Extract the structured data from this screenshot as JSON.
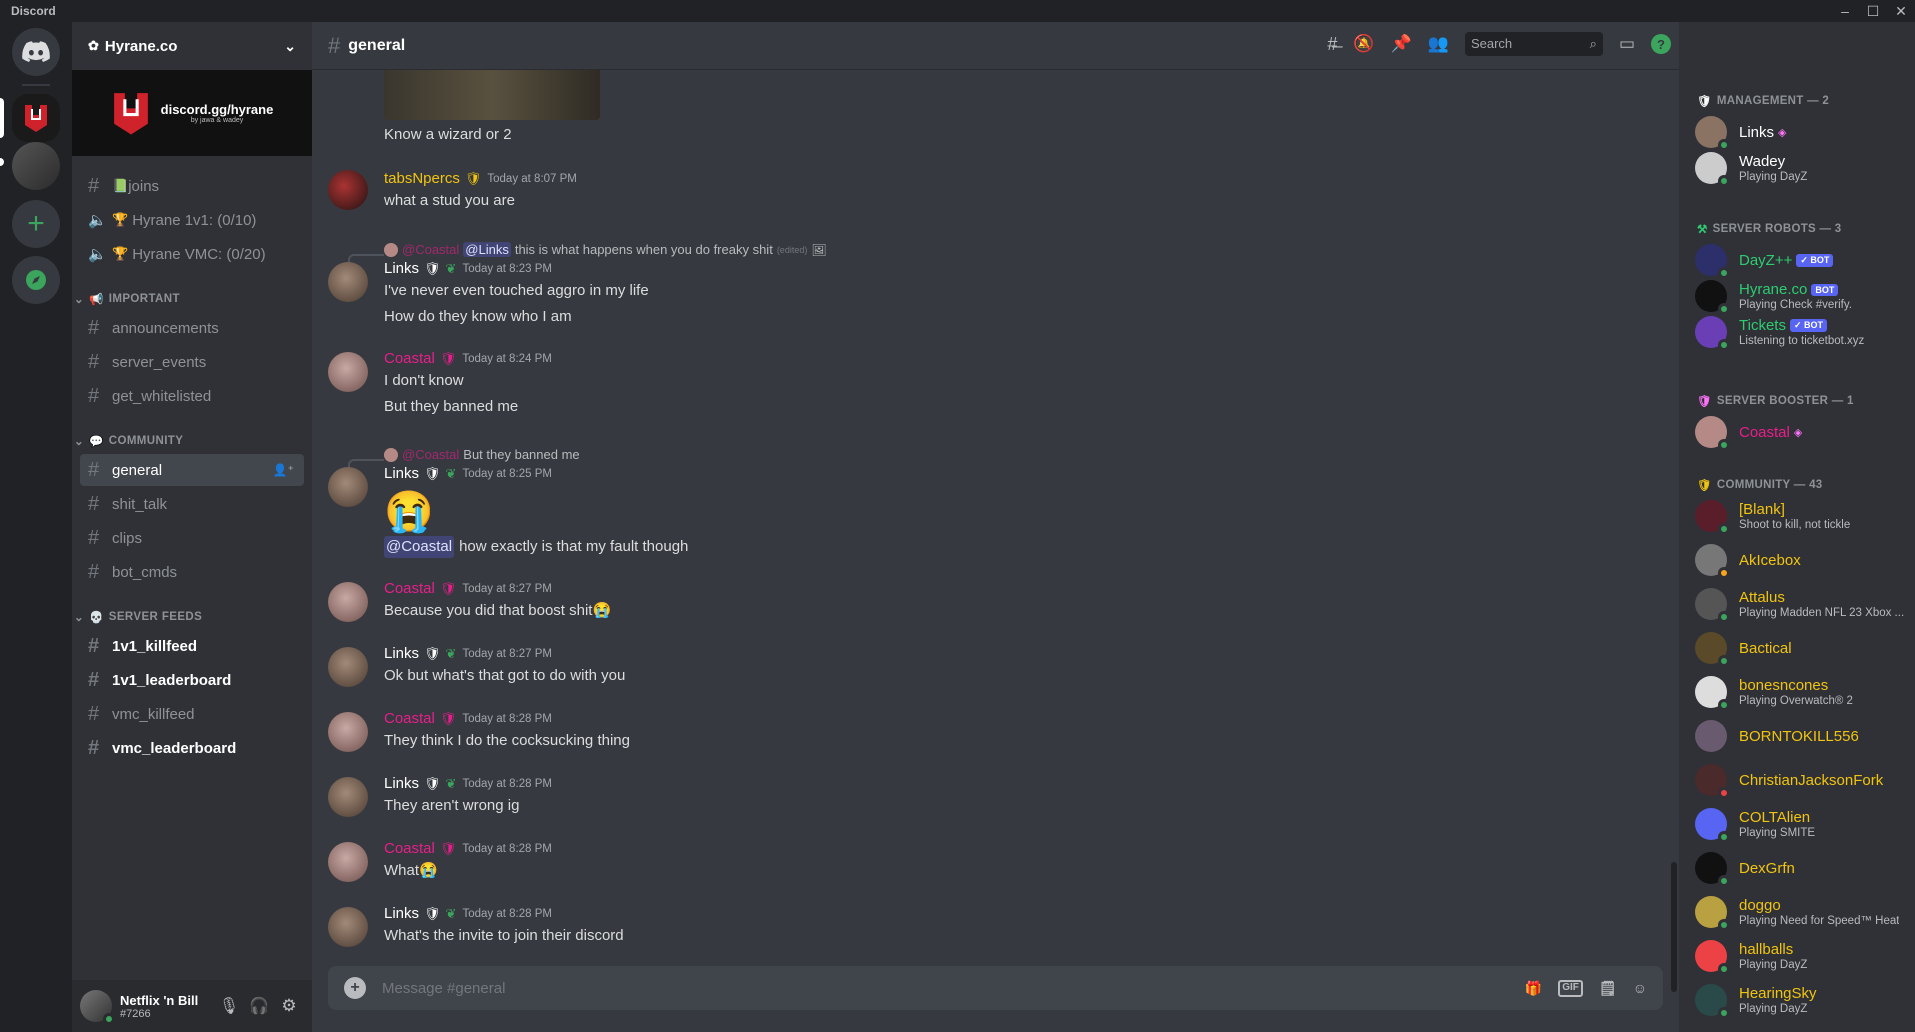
{
  "window": {
    "title": "Discord"
  },
  "server": {
    "name": "Hyrane.co",
    "banner_text": "discord.gg/hyrane",
    "banner_sub": "by jawa & wadey"
  },
  "channels": {
    "top": [
      {
        "name": "joins",
        "icon": "📗"
      },
      {
        "name": "Hyrane 1v1: (0/10)",
        "icon": "🏆"
      },
      {
        "name": "Hyrane VMC: (0/20)",
        "icon": "🏆"
      }
    ],
    "cat_important": "IMPORTANT",
    "important": [
      "announcements",
      "server_events",
      "get_whitelisted"
    ],
    "cat_community": "COMMUNITY",
    "community": [
      "general",
      "shit_talk",
      "clips",
      "bot_cmds"
    ],
    "cat_feeds": "SERVER FEEDS",
    "feeds": [
      "1v1_killfeed",
      "1v1_leaderboard",
      "vmc_killfeed",
      "vmc_leaderboard"
    ]
  },
  "user": {
    "name": "Netflix 'n Bill",
    "tag": "#7266"
  },
  "header": {
    "channel": "general",
    "search_placeholder": "Search"
  },
  "messages": {
    "m0": {
      "text": "Know a wizard or 2"
    },
    "m1": {
      "author": "tabsNpercs",
      "time": "Today at 8:07 PM",
      "lines": [
        "what a stud you are"
      ]
    },
    "m2": {
      "reply_author": "@Coastal",
      "reply_mention": "@Links",
      "reply_text": "this is what happens when you do freaky shit",
      "reply_edited": "(edited)",
      "author": "Links",
      "time": "Today at 8:23 PM",
      "lines": [
        "I've never even touched aggro in my life",
        "How do they know who I am"
      ]
    },
    "m3": {
      "author": "Coastal",
      "time": "Today at 8:24 PM",
      "lines": [
        "I don't know",
        "But they banned me"
      ]
    },
    "m4": {
      "reply_author": "@Coastal",
      "reply_text": "But they banned me",
      "author": "Links",
      "time": "Today at 8:25 PM",
      "emoji": "😭",
      "mention": "@Coastal",
      "text": "how exactly is that my fault though"
    },
    "m5": {
      "author": "Coastal",
      "time": "Today at 8:27 PM",
      "lines": [
        "Because you did that boost shit😭"
      ]
    },
    "m6": {
      "author": "Links",
      "time": "Today at 8:27 PM",
      "lines": [
        "Ok but what's that got to do with you"
      ]
    },
    "m7": {
      "author": "Coastal",
      "time": "Today at 8:28 PM",
      "lines": [
        "They think I do the cocksucking thing"
      ]
    },
    "m8": {
      "author": "Links",
      "time": "Today at 8:28 PM",
      "lines": [
        "They aren't wrong ig"
      ]
    },
    "m9": {
      "author": "Coastal",
      "time": "Today at 8:28 PM",
      "lines": [
        "What😭"
      ]
    },
    "m10": {
      "author": "Links",
      "time": "Today at 8:28 PM",
      "lines": [
        "What's the invite to join their discord"
      ]
    }
  },
  "composer": {
    "placeholder": "Message #general",
    "gif": "GIF"
  },
  "members": {
    "cat_management": "MANAGEMENT — 2",
    "cat_robots": "SERVER ROBOTS — 3",
    "cat_booster": "SERVER BOOSTER — 1",
    "cat_community": "COMMUNITY — 43",
    "bot_label": "✓ BOT",
    "list": [
      {
        "name": "Links",
        "activity": ""
      },
      {
        "name": "Wadey",
        "activity": "Playing DayZ"
      },
      {
        "name": "DayZ++",
        "activity": ""
      },
      {
        "name": "Hyrane.co",
        "activity": "Playing Check #verify."
      },
      {
        "name": "Tickets",
        "activity": "Listening to ticketbot.xyz"
      },
      {
        "name": "Coastal",
        "activity": ""
      },
      {
        "name": "[Blank]",
        "activity": "Shoot to kill, not tickle"
      },
      {
        "name": "AkIcebox",
        "activity": ""
      },
      {
        "name": "Attalus",
        "activity": "Playing Madden NFL 23 Xbox ..."
      },
      {
        "name": "Bactical",
        "activity": ""
      },
      {
        "name": "bonesncones",
        "activity": "Playing Overwatch® 2"
      },
      {
        "name": "BORNTOKILL556",
        "activity": ""
      },
      {
        "name": "ChristianJacksonFork",
        "activity": ""
      },
      {
        "name": "COLTAlien",
        "activity": "Playing SMITE"
      },
      {
        "name": "DexGrfn",
        "activity": ""
      },
      {
        "name": "doggo",
        "activity": "Playing Need for Speed™ Heat"
      },
      {
        "name": "hallballs",
        "activity": "Playing DayZ"
      },
      {
        "name": "HearingSky",
        "activity": "Playing DayZ"
      }
    ]
  },
  "colors": {
    "coastal": "#e91e8c",
    "links": "#ffffff",
    "tabs": "#f1c40f",
    "community": "#f1c40f",
    "bots": "#2ecc71",
    "online": "#3ba55d",
    "dnd": "#ed4245",
    "idle": "#faa61a"
  }
}
